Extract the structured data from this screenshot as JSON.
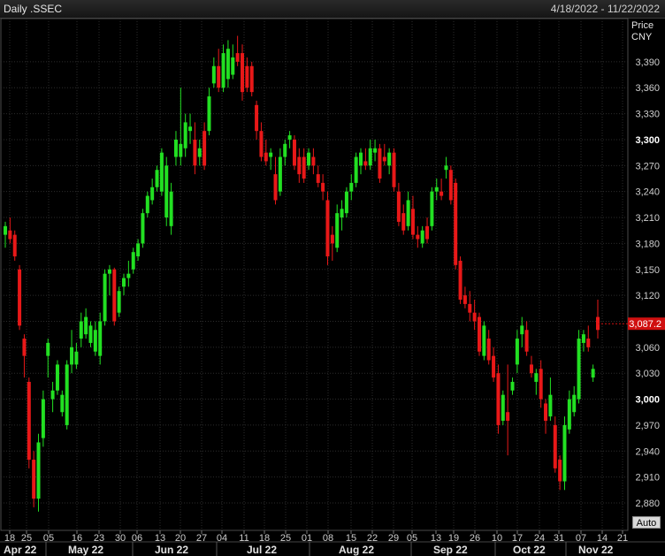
{
  "window": {
    "title": "Daily .SSEC",
    "date_range": "4/18/2022 - 11/22/2022",
    "auto_label": "Auto"
  },
  "colors": {
    "up": "#22e022",
    "down": "#e81818",
    "last_price_bg": "#d01010",
    "grid": "#2c2c2c",
    "background": "#000000"
  },
  "chart_data": {
    "type": "candlestick",
    "y_axis_title": [
      "Price",
      "CNY"
    ],
    "ylim": [
      2855,
      3420
    ],
    "y_ticks": [
      "2,880",
      "2,910",
      "2,940",
      "2,970",
      "3,000",
      "3,030",
      "3,060",
      "3,090",
      "3,120",
      "3,150",
      "3,180",
      "3,210",
      "3,240",
      "3,270",
      "3,300",
      "3,330",
      "3,360",
      "3,390"
    ],
    "y_bold_ticks": [
      "3,000",
      "3,300"
    ],
    "last_price": "3,087.2",
    "x_day_ticks": [
      "18",
      "25",
      "05",
      "16",
      "23",
      "30",
      "06",
      "13",
      "20",
      "27",
      "04",
      "11",
      "18",
      "25",
      "01",
      "08",
      "15",
      "22",
      "29",
      "05",
      "13",
      "19",
      "26",
      "10",
      "17",
      "24",
      "31",
      "07",
      "14",
      "21"
    ],
    "x_month_labels": [
      "Apr 22",
      "May 22",
      "Jun 22",
      "Jul 22",
      "Aug 22",
      "Sep 22",
      "Oct 22",
      "Nov 22"
    ],
    "candles": [
      {
        "o": 3190,
        "h": 3205,
        "l": 3175,
        "c": 3200
      },
      {
        "o": 3195,
        "h": 3210,
        "l": 3180,
        "c": 3185
      },
      {
        "o": 3190,
        "h": 3195,
        "l": 3160,
        "c": 3165
      },
      {
        "o": 3150,
        "h": 3155,
        "l": 3080,
        "c": 3085
      },
      {
        "o": 3070,
        "h": 3075,
        "l": 3025,
        "c": 3050
      },
      {
        "o": 3020,
        "h": 3025,
        "l": 2920,
        "c": 2930
      },
      {
        "o": 2930,
        "h": 2940,
        "l": 2875,
        "c": 2885
      },
      {
        "o": 2885,
        "h": 2960,
        "l": 2870,
        "c": 2950
      },
      {
        "o": 2955,
        "h": 3010,
        "l": 2945,
        "c": 3000
      },
      {
        "o": 3050,
        "h": 3070,
        "l": 3025,
        "c": 3065
      },
      {
        "o": 3000,
        "h": 3020,
        "l": 2985,
        "c": 3010
      },
      {
        "o": 3010,
        "h": 3045,
        "l": 3005,
        "c": 3040
      },
      {
        "o": 2985,
        "h": 3010,
        "l": 2980,
        "c": 3005
      },
      {
        "o": 2970,
        "h": 3045,
        "l": 2965,
        "c": 3040
      },
      {
        "o": 3040,
        "h": 3080,
        "l": 3030,
        "c": 3060
      },
      {
        "o": 3040,
        "h": 3065,
        "l": 3035,
        "c": 3055
      },
      {
        "o": 3070,
        "h": 3100,
        "l": 3060,
        "c": 3090
      },
      {
        "o": 3075,
        "h": 3105,
        "l": 3070,
        "c": 3095
      },
      {
        "o": 3065,
        "h": 3090,
        "l": 3060,
        "c": 3085
      },
      {
        "o": 3055,
        "h": 3090,
        "l": 3050,
        "c": 3080
      },
      {
        "o": 3050,
        "h": 3100,
        "l": 3040,
        "c": 3090
      },
      {
        "o": 3090,
        "h": 3150,
        "l": 3085,
        "c": 3145
      },
      {
        "o": 3145,
        "h": 3155,
        "l": 3120,
        "c": 3150
      },
      {
        "o": 3150,
        "h": 3152,
        "l": 3085,
        "c": 3090
      },
      {
        "o": 3100,
        "h": 3130,
        "l": 3095,
        "c": 3125
      },
      {
        "o": 3130,
        "h": 3145,
        "l": 3120,
        "c": 3140
      },
      {
        "o": 3140,
        "h": 3160,
        "l": 3130,
        "c": 3145
      },
      {
        "o": 3150,
        "h": 3175,
        "l": 3145,
        "c": 3170
      },
      {
        "o": 3165,
        "h": 3185,
        "l": 3160,
        "c": 3180
      },
      {
        "o": 3180,
        "h": 3220,
        "l": 3175,
        "c": 3215
      },
      {
        "o": 3215,
        "h": 3240,
        "l": 3210,
        "c": 3235
      },
      {
        "o": 3230,
        "h": 3255,
        "l": 3225,
        "c": 3245
      },
      {
        "o": 3245,
        "h": 3270,
        "l": 3240,
        "c": 3265
      },
      {
        "o": 3240,
        "h": 3290,
        "l": 3235,
        "c": 3285
      },
      {
        "o": 3210,
        "h": 3280,
        "l": 3200,
        "c": 3270
      },
      {
        "o": 3200,
        "h": 3250,
        "l": 3190,
        "c": 3240
      },
      {
        "o": 3280,
        "h": 3310,
        "l": 3270,
        "c": 3300
      },
      {
        "o": 3280,
        "h": 3360,
        "l": 3270,
        "c": 3295
      },
      {
        "o": 3290,
        "h": 3330,
        "l": 3280,
        "c": 3320
      },
      {
        "o": 3310,
        "h": 3330,
        "l": 3295,
        "c": 3315
      },
      {
        "o": 3300,
        "h": 3320,
        "l": 3260,
        "c": 3270
      },
      {
        "o": 3280,
        "h": 3300,
        "l": 3270,
        "c": 3290
      },
      {
        "o": 3310,
        "h": 3320,
        "l": 3265,
        "c": 3270
      },
      {
        "o": 3310,
        "h": 3360,
        "l": 3305,
        "c": 3350
      },
      {
        "o": 3365,
        "h": 3395,
        "l": 3360,
        "c": 3385
      },
      {
        "o": 3385,
        "h": 3405,
        "l": 3355,
        "c": 3360
      },
      {
        "o": 3360,
        "h": 3410,
        "l": 3355,
        "c": 3400
      },
      {
        "o": 3370,
        "h": 3415,
        "l": 3360,
        "c": 3405
      },
      {
        "o": 3375,
        "h": 3410,
        "l": 3370,
        "c": 3395
      },
      {
        "o": 3400,
        "h": 3420,
        "l": 3385,
        "c": 3390
      },
      {
        "o": 3400,
        "h": 3410,
        "l": 3345,
        "c": 3355
      },
      {
        "o": 3385,
        "h": 3395,
        "l": 3355,
        "c": 3360
      },
      {
        "o": 3385,
        "h": 3390,
        "l": 3350,
        "c": 3355
      },
      {
        "o": 3340,
        "h": 3345,
        "l": 3300,
        "c": 3310
      },
      {
        "o": 3310,
        "h": 3320,
        "l": 3275,
        "c": 3280
      },
      {
        "o": 3285,
        "h": 3300,
        "l": 3270,
        "c": 3275
      },
      {
        "o": 3280,
        "h": 3290,
        "l": 3265,
        "c": 3285
      },
      {
        "o": 3260,
        "h": 3280,
        "l": 3225,
        "c": 3230
      },
      {
        "o": 3240,
        "h": 3290,
        "l": 3235,
        "c": 3280
      },
      {
        "o": 3280,
        "h": 3300,
        "l": 3270,
        "c": 3295
      },
      {
        "o": 3300,
        "h": 3310,
        "l": 3290,
        "c": 3305
      },
      {
        "o": 3300,
        "h": 3305,
        "l": 3265,
        "c": 3270
      },
      {
        "o": 3280,
        "h": 3290,
        "l": 3250,
        "c": 3260
      },
      {
        "o": 3280,
        "h": 3290,
        "l": 3250,
        "c": 3255
      },
      {
        "o": 3270,
        "h": 3290,
        "l": 3265,
        "c": 3285
      },
      {
        "o": 3280,
        "h": 3290,
        "l": 3260,
        "c": 3270
      },
      {
        "o": 3260,
        "h": 3270,
        "l": 3245,
        "c": 3250
      },
      {
        "o": 3250,
        "h": 3260,
        "l": 3230,
        "c": 3240
      },
      {
        "o": 3230,
        "h": 3240,
        "l": 3155,
        "c": 3165
      },
      {
        "o": 3190,
        "h": 3200,
        "l": 3160,
        "c": 3180
      },
      {
        "o": 3175,
        "h": 3225,
        "l": 3170,
        "c": 3215
      },
      {
        "o": 3210,
        "h": 3230,
        "l": 3195,
        "c": 3220
      },
      {
        "o": 3215,
        "h": 3245,
        "l": 3210,
        "c": 3240
      },
      {
        "o": 3240,
        "h": 3260,
        "l": 3230,
        "c": 3250
      },
      {
        "o": 3250,
        "h": 3285,
        "l": 3245,
        "c": 3280
      },
      {
        "o": 3270,
        "h": 3290,
        "l": 3260,
        "c": 3285
      },
      {
        "o": 3275,
        "h": 3290,
        "l": 3265,
        "c": 3270
      },
      {
        "o": 3270,
        "h": 3300,
        "l": 3265,
        "c": 3290
      },
      {
        "o": 3285,
        "h": 3300,
        "l": 3275,
        "c": 3290
      },
      {
        "o": 3290,
        "h": 3295,
        "l": 3250,
        "c": 3255
      },
      {
        "o": 3280,
        "h": 3295,
        "l": 3270,
        "c": 3275
      },
      {
        "o": 3270,
        "h": 3290,
        "l": 3260,
        "c": 3285
      },
      {
        "o": 3285,
        "h": 3290,
        "l": 3240,
        "c": 3245
      },
      {
        "o": 3240,
        "h": 3250,
        "l": 3200,
        "c": 3205
      },
      {
        "o": 3215,
        "h": 3225,
        "l": 3190,
        "c": 3195
      },
      {
        "o": 3200,
        "h": 3240,
        "l": 3195,
        "c": 3230
      },
      {
        "o": 3220,
        "h": 3235,
        "l": 3185,
        "c": 3190
      },
      {
        "o": 3190,
        "h": 3200,
        "l": 3175,
        "c": 3185
      },
      {
        "o": 3180,
        "h": 3200,
        "l": 3175,
        "c": 3195
      },
      {
        "o": 3200,
        "h": 3210,
        "l": 3180,
        "c": 3185
      },
      {
        "o": 3200,
        "h": 3245,
        "l": 3195,
        "c": 3240
      },
      {
        "o": 3240,
        "h": 3255,
        "l": 3230,
        "c": 3245
      },
      {
        "o": 3240,
        "h": 3255,
        "l": 3230,
        "c": 3235
      },
      {
        "o": 3265,
        "h": 3280,
        "l": 3255,
        "c": 3270
      },
      {
        "o": 3265,
        "h": 3270,
        "l": 3225,
        "c": 3230
      },
      {
        "o": 3250,
        "h": 3255,
        "l": 3150,
        "c": 3155
      },
      {
        "o": 3160,
        "h": 3165,
        "l": 3110,
        "c": 3115
      },
      {
        "o": 3120,
        "h": 3130,
        "l": 3105,
        "c": 3110
      },
      {
        "o": 3110,
        "h": 3125,
        "l": 3090,
        "c": 3100
      },
      {
        "o": 3100,
        "h": 3115,
        "l": 3080,
        "c": 3090
      },
      {
        "o": 3095,
        "h": 3100,
        "l": 3050,
        "c": 3055
      },
      {
        "o": 3050,
        "h": 3090,
        "l": 3045,
        "c": 3085
      },
      {
        "o": 3070,
        "h": 3080,
        "l": 3040,
        "c": 3045
      },
      {
        "o": 3050,
        "h": 3060,
        "l": 3020,
        "c": 3025
      },
      {
        "o": 3030,
        "h": 3040,
        "l": 2960,
        "c": 2970
      },
      {
        "o": 2975,
        "h": 3010,
        "l": 2970,
        "c": 3005
      },
      {
        "o": 2985,
        "h": 3040,
        "l": 2935,
        "c": 2975
      },
      {
        "o": 3010,
        "h": 3025,
        "l": 3005,
        "c": 3020
      },
      {
        "o": 3040,
        "h": 3080,
        "l": 3030,
        "c": 3070
      },
      {
        "o": 3075,
        "h": 3095,
        "l": 3060,
        "c": 3085
      },
      {
        "o": 3080,
        "h": 3090,
        "l": 3050,
        "c": 3055
      },
      {
        "o": 3040,
        "h": 3050,
        "l": 3025,
        "c": 3030
      },
      {
        "o": 3020,
        "h": 3035,
        "l": 3005,
        "c": 3030
      },
      {
        "o": 3035,
        "h": 3045,
        "l": 2990,
        "c": 3000
      },
      {
        "o": 2995,
        "h": 3000,
        "l": 2960,
        "c": 2975
      },
      {
        "o": 2980,
        "h": 3025,
        "l": 2975,
        "c": 3005
      },
      {
        "o": 2970,
        "h": 2980,
        "l": 2915,
        "c": 2920
      },
      {
        "o": 2930,
        "h": 2935,
        "l": 2895,
        "c": 2905
      },
      {
        "o": 2905,
        "h": 2980,
        "l": 2895,
        "c": 2970
      },
      {
        "o": 2965,
        "h": 3010,
        "l": 2960,
        "c": 3000
      },
      {
        "o": 2985,
        "h": 3015,
        "l": 2980,
        "c": 3005
      },
      {
        "o": 3000,
        "h": 3080,
        "l": 2995,
        "c": 3070
      },
      {
        "o": 3065,
        "h": 3080,
        "l": 3055,
        "c": 3075
      },
      {
        "o": 3070,
        "h": 3085,
        "l": 3055,
        "c": 3060
      },
      {
        "o": 3025,
        "h": 3040,
        "l": 3020,
        "c": 3035
      },
      {
        "o": 3095,
        "h": 3115,
        "l": 3070,
        "c": 3080
      }
    ]
  }
}
